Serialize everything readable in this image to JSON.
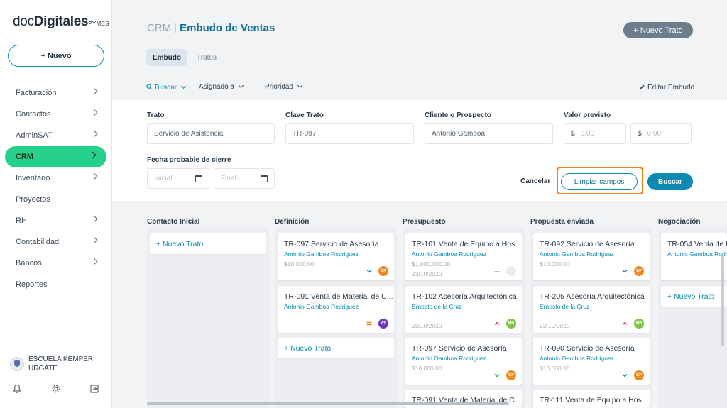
{
  "brand": {
    "part1": "doc",
    "part2": "Digitales",
    "part3": "PYMES"
  },
  "sidebar": {
    "new_label": "+ Nuevo",
    "items": [
      {
        "label": "Facturación",
        "chevron": true
      },
      {
        "label": "Contactos",
        "chevron": true
      },
      {
        "label": "AdminSAT",
        "chevron": true
      },
      {
        "label": "CRM",
        "chevron": true,
        "active": true
      },
      {
        "label": "Inventario",
        "chevron": true
      },
      {
        "label": "Proyectos",
        "chevron": false
      },
      {
        "label": "RH",
        "chevron": true
      },
      {
        "label": "Contabilidad",
        "chevron": true
      },
      {
        "label": "Bancos",
        "chevron": true
      },
      {
        "label": "Reportes",
        "chevron": false
      }
    ],
    "org_name_line1": "ESCUELA KEMPER",
    "org_name_line2": "URGATE",
    "footer_icons": [
      "bell-icon",
      "gear-icon",
      "logout-icon"
    ]
  },
  "header": {
    "crumb_parent": "CRM",
    "crumb_sep": "|",
    "crumb_current": "Embudo de Ventas",
    "new_deal_label": "+ Nuevo Trato"
  },
  "tabs": [
    {
      "label": "Embudo",
      "active": true
    },
    {
      "label": "Tratos",
      "active": false
    }
  ],
  "filters": {
    "search_label": "Buscar",
    "assigned_label": "Asignado a",
    "priority_label": "Prioridad",
    "edit_label": "Editar Embudo"
  },
  "form": {
    "deal_label": "Trato",
    "deal_value": "Servicio de Asistencia",
    "key_label": "Clave Trato",
    "key_value": "TR-097",
    "client_label": "Cliente o Prospecto",
    "client_value": "Antonio Gamboa",
    "amount_label": "Valor previsto",
    "currency": "$",
    "amount_min_placeholder": "0.00",
    "amount_max_placeholder": "0.00",
    "close_date_label": "Fecha probable de cierre",
    "date_start_placeholder": "Inicial",
    "date_end_placeholder": "Final",
    "cancel_label": "Cancelar",
    "clear_label": "Limpiar campos",
    "search_label": "Buscar"
  },
  "columns": [
    {
      "title": "Contacto Inicial",
      "cards": [],
      "add_label": "+ Nuevo Trato"
    },
    {
      "title": "Definición",
      "cards": [
        {
          "title": "TR-097 Servicio de Asesoría",
          "client": "Antonio Gamboa Rodriguez",
          "amount": "$10,000.00",
          "date": "",
          "priority": "low",
          "avatar": "GP",
          "avatar_color": "#ef8a1f"
        },
        {
          "title": "TR-091 Venta de Material de C...",
          "client": "Antonio Gamboa Rodriguez",
          "amount": "",
          "date": "",
          "priority": "medium",
          "avatar": "AT",
          "avatar_color": "#6d35c9"
        }
      ],
      "add_label": "+ Nuevo Trato"
    },
    {
      "title": "Presupuesto",
      "cards": [
        {
          "title": "TR-101 Venta de Equipo a Hos...",
          "client": "Antonio Gamboa Rodriguez",
          "amount": "$1,000,000.00",
          "date": "23/10/2020",
          "priority": "none",
          "avatar": "",
          "avatar_color": "#ececec"
        },
        {
          "title": "TR-102 Asesoría Arquitectónica",
          "client": "Ernesto de la Cruz",
          "amount": "",
          "date": "23/10/2020",
          "priority": "high",
          "avatar": "MB",
          "avatar_color": "#7ac943"
        },
        {
          "title": "TR-097 Servicio de Asesoría",
          "client": "Antonio Gamboa Rodriguez",
          "amount": "$10,000.00",
          "date": "",
          "priority": "lowest",
          "avatar": "GP",
          "avatar_color": "#ef8a1f"
        },
        {
          "title": "TR-091 Venta de Material de C...",
          "client": "",
          "amount": "",
          "date": "",
          "priority": "",
          "avatar": "",
          "avatar_color": ""
        }
      ]
    },
    {
      "title": "Propuesta enviada",
      "cards": [
        {
          "title": "TR-092 Servicio de Asesoría",
          "client": "Antonio Gamboa Rodriguez",
          "amount": "$10,000.00",
          "date": "",
          "priority": "low",
          "avatar": "GP",
          "avatar_color": "#ef8a1f"
        },
        {
          "title": "TR-205 Asesoría Arquitectónica",
          "client": "Ernesto de la Cruz",
          "amount": "",
          "date": "23/10/2020",
          "priority": "high",
          "avatar": "MB",
          "avatar_color": "#7ac943"
        },
        {
          "title": "TR-090 Servicio de Asesoría",
          "client": "Antonio Gamboa Rodriguez",
          "amount": "$10,000.00",
          "date": "",
          "priority": "low",
          "avatar": "GP",
          "avatar_color": "#ef8a1f"
        },
        {
          "title": "TR-111 Venta de Equipo a Hos...",
          "client": "",
          "amount": "",
          "date": "",
          "priority": "",
          "avatar": "",
          "avatar_color": ""
        }
      ]
    },
    {
      "title": "Negociación",
      "cards": [
        {
          "title": "TR-054 Venta de M",
          "client": "Antonio Gamboa Rodri",
          "amount": "",
          "date": "",
          "priority": "",
          "avatar": "",
          "avatar_color": ""
        }
      ],
      "add_label": "+ Nuevo Trato"
    }
  ],
  "colors": {
    "accent": "#0b8bb3",
    "active_nav": "#25d18a",
    "highlight": "#ef7d1a",
    "header_button": "#6d7d8c"
  }
}
